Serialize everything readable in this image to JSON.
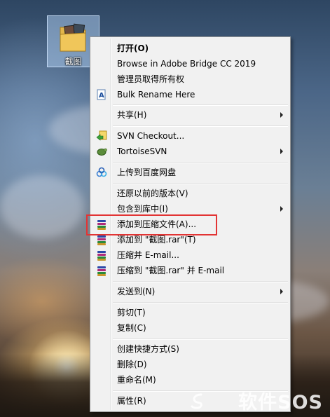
{
  "desktop": {
    "icon_label": "截图"
  },
  "menu": {
    "items": [
      {
        "label": "打开(O)",
        "bold": true
      },
      {
        "label": "Browse in Adobe Bridge CC 2019"
      },
      {
        "label": "管理员取得所有权"
      },
      {
        "label": "Bulk Rename Here",
        "icon": "bulk-rename-icon"
      },
      {
        "label": "共享(H)",
        "submenu": true
      },
      {
        "label": "SVN Checkout...",
        "icon": "svn-checkout-icon"
      },
      {
        "label": "TortoiseSVN",
        "icon": "tortoisesvn-icon",
        "submenu": true
      },
      {
        "label": "上传到百度网盘",
        "icon": "baidu-cloud-icon"
      },
      {
        "label": "还原以前的版本(V)"
      },
      {
        "label": "包含到库中(I)",
        "submenu": true
      },
      {
        "label": "添加到压缩文件(A)...",
        "icon": "winrar-icon"
      },
      {
        "label": "添加到 \"截图.rar\"(T)",
        "icon": "winrar-icon"
      },
      {
        "label": "压缩并 E-mail...",
        "icon": "winrar-icon"
      },
      {
        "label": "压缩到 \"截图.rar\" 并 E-mail",
        "icon": "winrar-icon"
      },
      {
        "label": "发送到(N)",
        "submenu": true
      },
      {
        "label": "剪切(T)"
      },
      {
        "label": "复制(C)"
      },
      {
        "label": "创建快捷方式(S)"
      },
      {
        "label": "删除(D)"
      },
      {
        "label": "重命名(M)"
      },
      {
        "label": "属性(R)"
      }
    ]
  },
  "watermark": {
    "text": "软件SOS"
  },
  "colors": {
    "highlight_border": "#e23434",
    "menu_background": "#f1f1f1"
  }
}
